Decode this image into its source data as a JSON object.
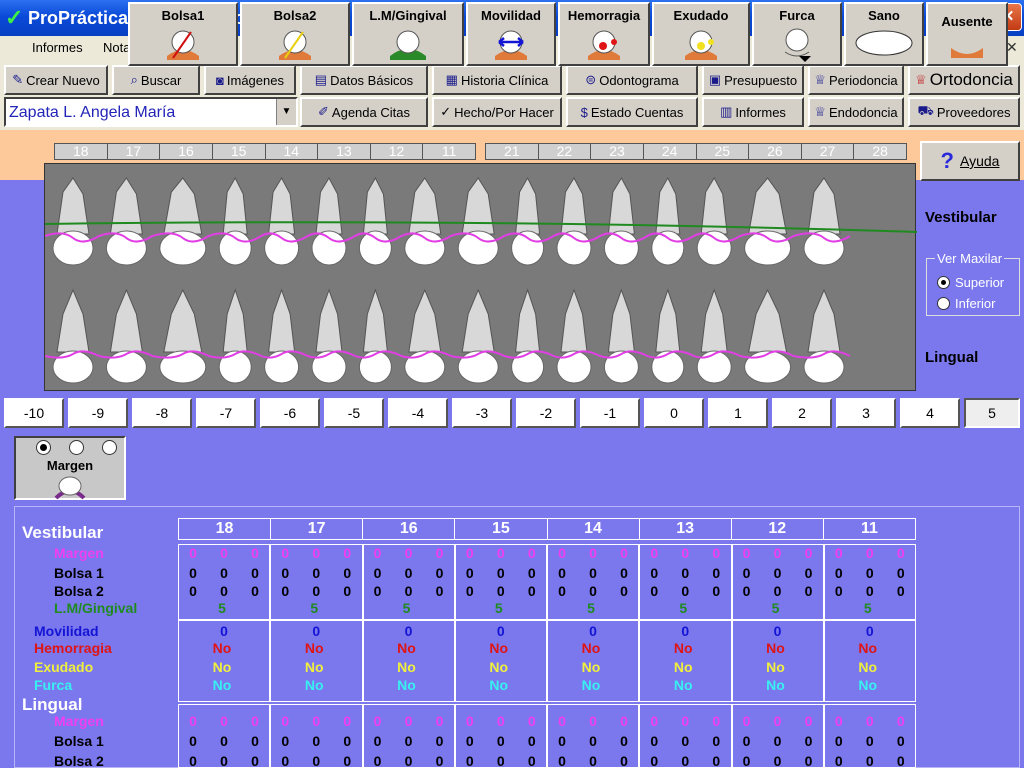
{
  "window": {
    "title": "ProPráctica - [Periodontograma]",
    "controls": {
      "minimize": "▁",
      "restore": "❐",
      "close": "✕"
    }
  },
  "menu": {
    "items": [
      "Informes",
      "Notas Adhesivas"
    ],
    "mdi": {
      "minimize": "_",
      "restore": "❐",
      "close": "✕"
    }
  },
  "toolbar": {
    "crear_nuevo": "Crear Nuevo",
    "buscar": "Buscar",
    "imagenes": "Imágenes",
    "datos_basicos": "Datos Básicos",
    "historia_clinica": "Historia Clínica",
    "odontograma": "Odontograma",
    "presupuesto": "Presupuesto",
    "periodoncia": "Periodoncia",
    "ortodoncia": "Ortodoncia",
    "agenda_citas": "Agenda Citas",
    "hecho_por_hacer": "Hecho/Por Hacer",
    "estado_cuentas": "Estado Cuentas",
    "informes": "Informes",
    "endodoncia": "Endodoncia",
    "proveedores": "Proveedores"
  },
  "patient": {
    "name": "Zapata L. Angela María"
  },
  "upper_numbers_right": [
    "18",
    "17",
    "16",
    "15",
    "14",
    "13",
    "12",
    "11"
  ],
  "upper_numbers_left": [
    "21",
    "22",
    "23",
    "24",
    "25",
    "26",
    "27",
    "28"
  ],
  "help": {
    "label": "Ayuda"
  },
  "labels": {
    "vestibular": "Vestibular",
    "lingual": "Lingual"
  },
  "ver_maxilar": {
    "title": "Ver Maxilar",
    "superior": "Superior",
    "inferior": "Inferior",
    "selected": "superior"
  },
  "scale": {
    "values": [
      "-10",
      "-9",
      "-8",
      "-7",
      "-6",
      "-5",
      "-4",
      "-3",
      "-2",
      "-1",
      "0",
      "1",
      "2",
      "3",
      "4",
      "5"
    ],
    "selected": "5"
  },
  "tools": {
    "margen": "Margen",
    "bolsa1": "Bolsa1",
    "bolsa2": "Bolsa2",
    "lm_gingival": "L.M/Gingival",
    "movilidad": "Movilidad",
    "hemorragia": "Hemorragia",
    "exudado": "Exudado",
    "furca": "Furca",
    "sano": "Sano",
    "ausente": "Ausente"
  },
  "grid": {
    "teeth": [
      "18",
      "17",
      "16",
      "15",
      "14",
      "13",
      "12",
      "11"
    ],
    "sections": {
      "vestibular": "Vestibular",
      "lingual": "Lingual"
    },
    "rows": {
      "margen": "Margen",
      "bolsa1": "Bolsa 1",
      "bolsa2": "Bolsa 2",
      "lm_gingival": "L.M/Gingival",
      "movilidad": "Movilidad",
      "hemorragia": "Hemorragia",
      "exudado": "Exudado",
      "furca": "Furca"
    },
    "values": {
      "margen": "0",
      "bolsa": "0",
      "lm_gingival": "5",
      "movilidad": "0",
      "hemorragia": "No",
      "exudado": "No",
      "furca": "No"
    }
  },
  "colors": {
    "background": "#7b78ee",
    "margen": "#f23ef2",
    "bolsa": "#000000",
    "lm_gingival": "#1f8a1f",
    "movilidad": "#1414d4",
    "hemorragia": "#e01414",
    "exudado": "#f0f03c",
    "furca": "#38f0f0"
  }
}
